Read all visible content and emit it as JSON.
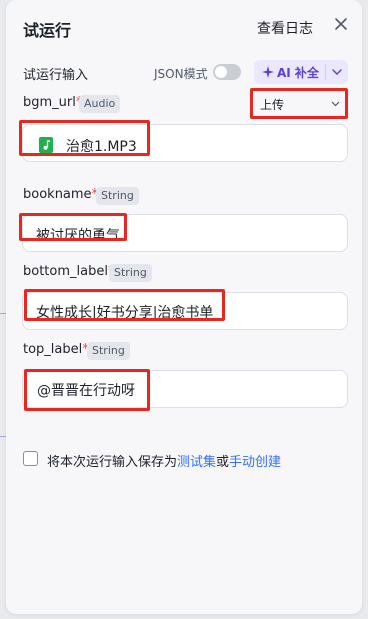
{
  "header": {
    "title": "试运行",
    "view_log": "查看日志"
  },
  "run_input": {
    "label": "试运行输入",
    "json_mode_label": "JSON模式",
    "json_mode_enabled": false,
    "ai_fill_label": "AI 补全"
  },
  "fields": [
    {
      "name": "bgm_url",
      "required_mark": "*",
      "type": "Audio",
      "upload_mode": "上传",
      "value": "治愈1.MP3"
    },
    {
      "name": "bookname",
      "required_mark": "*",
      "type": "String",
      "value": "被讨厌的勇气"
    },
    {
      "name": "bottom_label",
      "required_mark": "*",
      "type": "String",
      "value": "女性成长|好书分享|治愈书单"
    },
    {
      "name": "top_label",
      "required_mark": "*",
      "type": "String",
      "value": "@晋晋在行动呀"
    }
  ],
  "save": {
    "checked": false,
    "text_before": "将本次运行输入保存为",
    "link_test_set": "测试集",
    "text_or": "或",
    "link_manual_create": "手动创建"
  },
  "colors": {
    "accent": "#3370ff",
    "ai_purple": "#5b3fd9",
    "annotation_red": "#e8271e",
    "file_green": "#21b04b"
  }
}
